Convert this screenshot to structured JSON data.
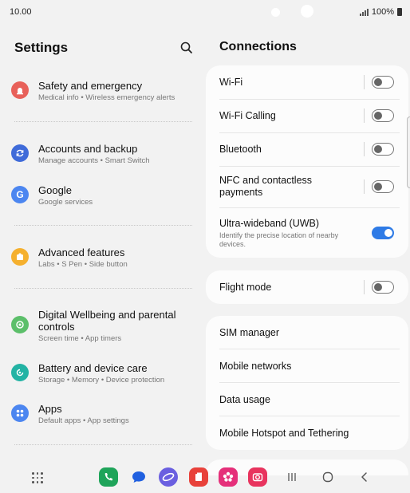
{
  "status_bar": {
    "time": "10.00",
    "battery": "100%"
  },
  "left_pane": {
    "title": "Settings",
    "items": [
      {
        "label": "Safety and emergency",
        "sub": "Medical info • Wireless emergency alerts",
        "icon": "siren-icon",
        "color": "#e8615a"
      },
      {
        "label": "Accounts and backup",
        "sub": "Manage accounts • Smart Switch",
        "icon": "sync-icon",
        "color": "#3f6bd9"
      },
      {
        "label": "Google",
        "sub": "Google services",
        "icon": "google-icon",
        "color": "#4c86f0"
      },
      {
        "label": "Advanced features",
        "sub": "Labs • S Pen • Side button",
        "icon": "puzzle-icon",
        "color": "#f5b02e"
      },
      {
        "label": "Digital Wellbeing and parental controls",
        "sub": "Screen time • App timers",
        "icon": "wellbeing-icon",
        "color": "#5cbf6a"
      },
      {
        "label": "Battery and device care",
        "sub": "Storage • Memory • Device protection",
        "icon": "device-care-icon",
        "color": "#23b3a4"
      },
      {
        "label": "Apps",
        "sub": "Default apps • App settings",
        "icon": "apps-icon",
        "color": "#4c86f0"
      }
    ]
  },
  "right_pane": {
    "title": "Connections",
    "wifi": {
      "label": "Wi-Fi",
      "on": false
    },
    "wifi_calling": {
      "label": "Wi-Fi Calling",
      "on": false
    },
    "bluetooth": {
      "label": "Bluetooth",
      "on": false
    },
    "nfc": {
      "label": "NFC and contactless payments",
      "on": false
    },
    "uwb": {
      "label": "Ultra-wideband (UWB)",
      "desc": "Identify the precise location of nearby devices.",
      "on": true
    },
    "flight_mode": {
      "label": "Flight mode",
      "on": false
    },
    "sim_manager": {
      "label": "SIM manager"
    },
    "mobile_networks": {
      "label": "Mobile networks"
    },
    "data_usage": {
      "label": "Data usage"
    },
    "hotspot": {
      "label": "Mobile Hotspot and Tethering"
    }
  },
  "dock": {
    "apps": [
      {
        "name": "phone-app-icon",
        "color": "#1fa45a"
      },
      {
        "name": "messages-app-icon",
        "color": "#2060e0"
      },
      {
        "name": "internet-app-icon",
        "color": "#6a5fe0"
      },
      {
        "name": "notes-app-icon",
        "color": "#e8413a"
      },
      {
        "name": "gallery-app-icon",
        "color": "#e5307a"
      },
      {
        "name": "camera-app-icon",
        "color": "#e8345e"
      }
    ]
  },
  "colors": {
    "accent": "#2f7be6",
    "background": "#f2f2f2",
    "card": "#fcfcfc"
  }
}
